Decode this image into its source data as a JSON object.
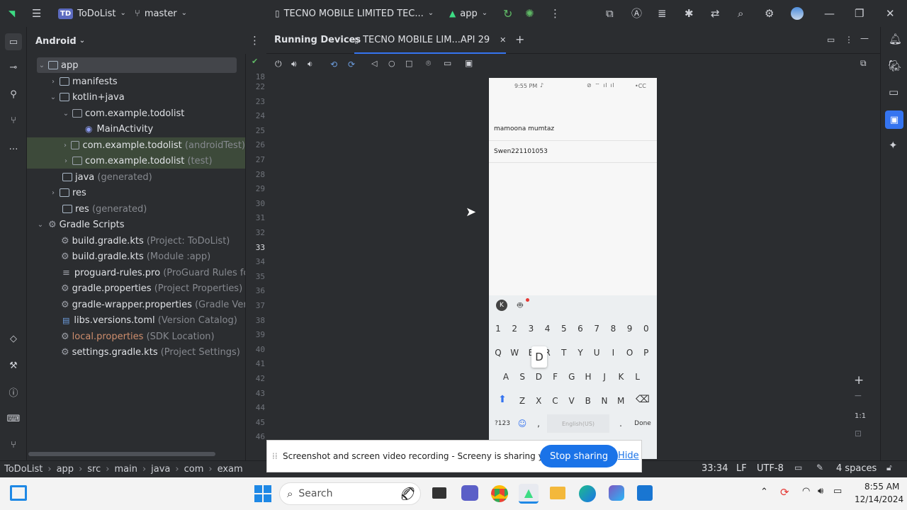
{
  "titlebar": {
    "project_badge": "TD",
    "project_name": "ToDoList",
    "branch": "master",
    "device": "TECNO MOBILE LIMITED TEC...",
    "run_config": "app"
  },
  "project_panel": {
    "view_mode": "Android",
    "items": [
      {
        "label": "app",
        "hint": ""
      },
      {
        "label": "manifests",
        "hint": ""
      },
      {
        "label": "kotlin+java",
        "hint": ""
      },
      {
        "label": "com.example.todolist",
        "hint": ""
      },
      {
        "label": "MainActivity",
        "hint": ""
      },
      {
        "label": "com.example.todolist",
        "hint": "(androidTest)"
      },
      {
        "label": "com.example.todolist",
        "hint": "(test)"
      },
      {
        "label": "java",
        "hint": "(generated)"
      },
      {
        "label": "res",
        "hint": ""
      },
      {
        "label": "res",
        "hint": "(generated)"
      },
      {
        "label": "Gradle Scripts",
        "hint": ""
      },
      {
        "label": "build.gradle.kts",
        "hint": "(Project: ToDoList)"
      },
      {
        "label": "build.gradle.kts",
        "hint": "(Module :app)"
      },
      {
        "label": "proguard-rules.pro",
        "hint": "(ProGuard Rules for \""
      },
      {
        "label": "gradle.properties",
        "hint": "(Project Properties)"
      },
      {
        "label": "gradle-wrapper.properties",
        "hint": "(Gradle Versic"
      },
      {
        "label": "libs.versions.toml",
        "hint": "(Version Catalog)"
      },
      {
        "label": "local.properties",
        "hint": "(SDK Location)"
      },
      {
        "label": "settings.gradle.kts",
        "hint": "(Project Settings)"
      }
    ]
  },
  "gutter": {
    "lines": [
      "18",
      "22",
      "23",
      "24",
      "25",
      "26",
      "27",
      "28",
      "29",
      "30",
      "31",
      "32",
      "33",
      "34",
      "35",
      "36",
      "37",
      "38",
      "39",
      "40",
      "41",
      "42",
      "43",
      "44",
      "45",
      "46"
    ]
  },
  "running_devices": {
    "tab_label": "Running Devices",
    "device_tab": "TECNO MOBILE LIM...API 29"
  },
  "phone": {
    "status_time": "9:55 PM",
    "status_right": "•CC",
    "item1": "mamoona mumtaz",
    "item2": "Swen221101053",
    "keys_row1": [
      "1",
      "2",
      "3",
      "4",
      "5",
      "6",
      "7",
      "8",
      "9",
      "0"
    ],
    "keys_row2": [
      "Q",
      "W",
      "E",
      "R",
      "T",
      "Y",
      "U",
      "I",
      "O",
      "P"
    ],
    "keys_row3": [
      "A",
      "S",
      "D",
      "F",
      "G",
      "H",
      "J",
      "K",
      "L"
    ],
    "keys_row4": [
      "Z",
      "X",
      "C",
      "V",
      "B",
      "N",
      "M"
    ],
    "key_sym": "?123",
    "key_comma": ",",
    "key_dot": ".",
    "key_done": "Done",
    "key_space": "English(US)",
    "popup_key": "D"
  },
  "zoom": {
    "ratio": "1:1"
  },
  "statusbar": {
    "breadcrumbs": [
      "ToDoList",
      "app",
      "src",
      "main",
      "java",
      "com",
      "exam"
    ],
    "position": "33:34",
    "line_sep": "LF",
    "encoding": "UTF-8",
    "indent": "4 spaces"
  },
  "screeny": {
    "message": "Screenshot and screen video recording - Screeny is sharing your screen.",
    "stop_label": "Stop sharing",
    "hide_label": "Hide"
  },
  "taskbar": {
    "search_label": "Search",
    "time": "8:55 AM",
    "date": "12/14/2024"
  },
  "colors": {
    "accent": "#3574f0",
    "selection": "#393b40",
    "green_row": "#3d4a3a",
    "local_prop": "#cf8e6d",
    "taskbar": "#f3f3f3"
  }
}
